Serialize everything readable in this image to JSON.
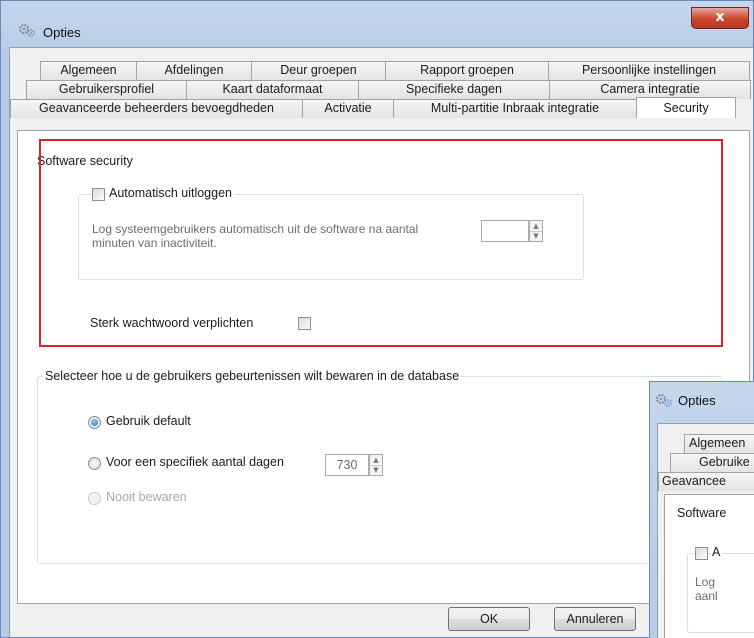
{
  "window": {
    "title": "Opties",
    "close_glyph": "x",
    "title_icon": "settings-gears-icon"
  },
  "tabs": {
    "row1": [
      "Algemeen",
      "Afdelingen",
      "Deur groepen",
      "Rapport groepen",
      "Persoonlijke instellingen"
    ],
    "row2": [
      "Gebruikersprofiel",
      "Kaart dataformaat",
      "Specifieke dagen",
      "Camera integratie"
    ],
    "row3": [
      "Geavanceerde beheerders bevoegdheden",
      "Activatie",
      "Multi-partitie Inbraak integratie",
      "Security"
    ],
    "active": "Security"
  },
  "software_security": {
    "legend": "Software security",
    "auto_logout": {
      "label": "Automatisch uitloggen",
      "checked": false,
      "description": "Log systeemgebruikers automatisch uit de software  na aantal minuten van inactiviteit.",
      "minutes_value": ""
    },
    "strong_password": {
      "label": "Sterk wachtwoord verplichten",
      "checked": false
    }
  },
  "events_storage": {
    "legend": "Selecteer hoe u de gebruikers gebeurtenissen wilt bewaren in de database",
    "options": [
      {
        "label": "Gebruik default",
        "selected": true,
        "enabled": true
      },
      {
        "label": "Voor een specifiek aantal dagen",
        "selected": false,
        "enabled": true
      },
      {
        "label": "Nooit bewaren",
        "selected": false,
        "enabled": false
      }
    ],
    "days_value": "730"
  },
  "buttons": {
    "ok": "OK",
    "cancel": "Annuleren"
  },
  "overlay_window": {
    "title": "Opties",
    "tabs": [
      "Algemeen",
      "Gebruike",
      "Geavancee"
    ],
    "legend": "Software",
    "checkbox_label": "A",
    "text_line1": "Log",
    "text_line2": "aanl"
  },
  "colors": {
    "highlight": "#d8242b",
    "window_frame": "#b6cbe6",
    "close_button": "#c9462c",
    "radio_selected": "#1f6fc2"
  }
}
